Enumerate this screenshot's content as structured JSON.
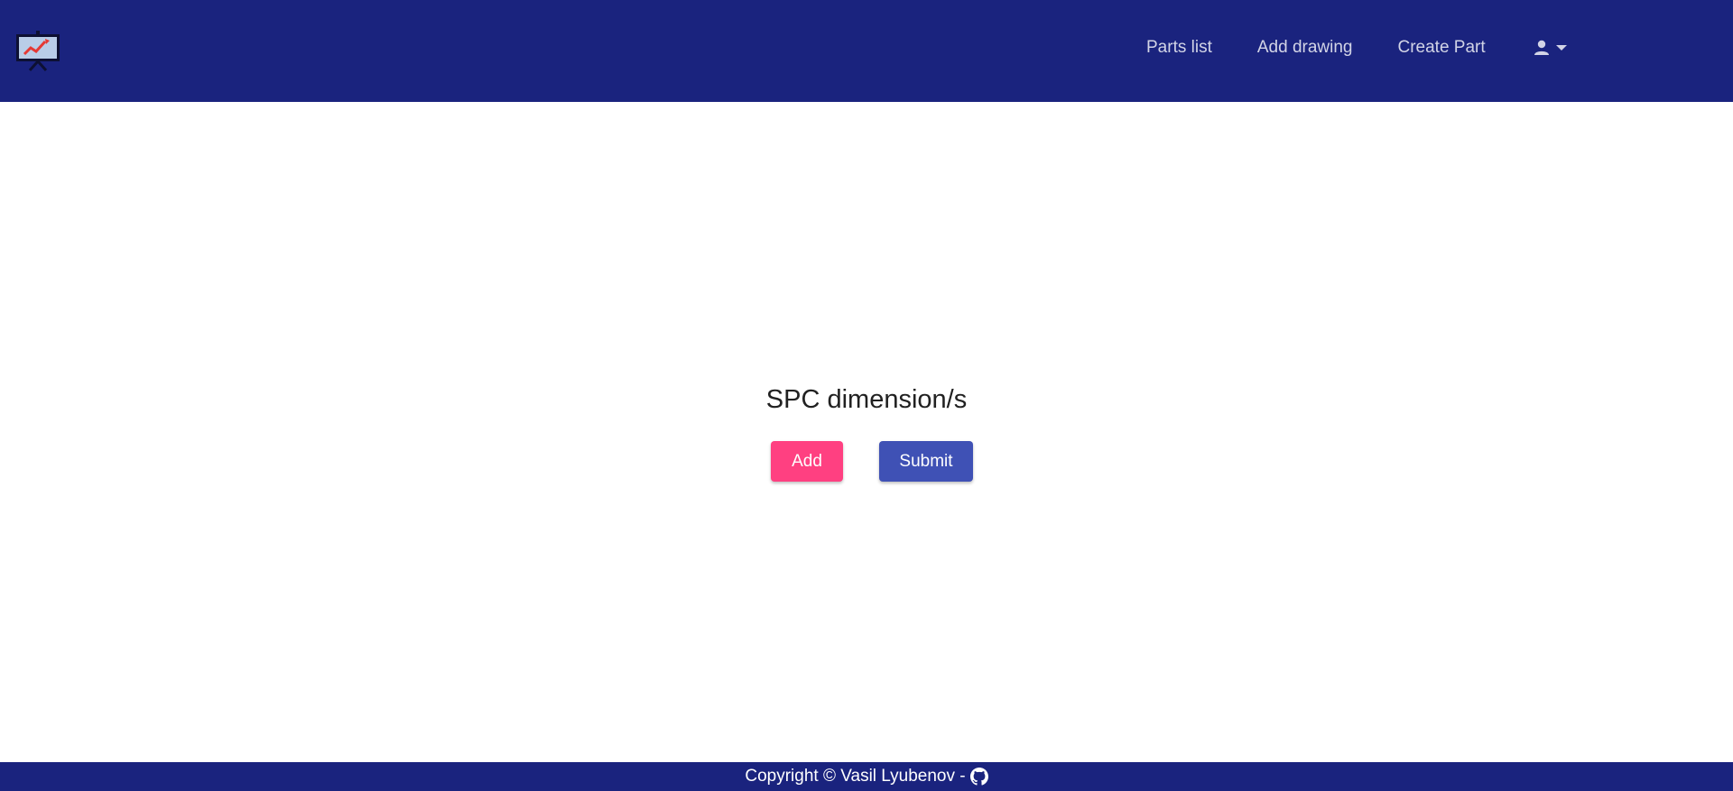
{
  "header": {
    "logo_icon": "presentation-chart-icon",
    "nav": {
      "parts_list": "Parts list",
      "add_drawing": "Add drawing",
      "create_part": "Create Part"
    },
    "user_menu_icon": "user-icon",
    "dropdown_icon": "caret-down-icon"
  },
  "main": {
    "title": "SPC dimension/s",
    "add_label": "Add",
    "submit_label": "Submit"
  },
  "footer": {
    "copyright": "Copyright © Vasil Lyubenov -",
    "github_icon": "github-icon"
  },
  "colors": {
    "navbar": "#1a237e",
    "nav_text": "#d2d4e6",
    "add_button": "#ff4081",
    "submit_button": "#3f51b5",
    "title_text": "#212121"
  }
}
